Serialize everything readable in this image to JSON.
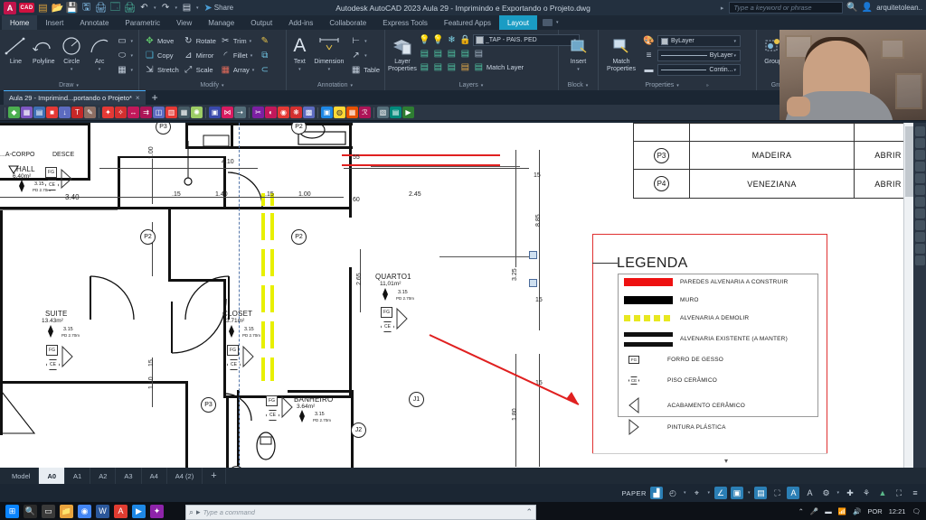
{
  "titlebar": {
    "app_title": "Autodesk AutoCAD 2023   Aula 29 - Imprimindo e Exportando o Projeto.dwg",
    "share_label": "Share",
    "search_placeholder": "Type a keyword or phrase",
    "user_name": "arquitetolean..",
    "quick_access": [
      "new-icon",
      "open-icon",
      "save-icon",
      "saveas-icon",
      "plot-icon",
      "print-icon",
      "undo-icon",
      "redo-icon"
    ]
  },
  "ribbon": {
    "tabs": [
      {
        "label": "Home",
        "state": "hover"
      },
      {
        "label": "Insert",
        "state": "normal"
      },
      {
        "label": "Annotate",
        "state": "normal"
      },
      {
        "label": "Parametric",
        "state": "normal"
      },
      {
        "label": "View",
        "state": "normal"
      },
      {
        "label": "Manage",
        "state": "normal"
      },
      {
        "label": "Output",
        "state": "normal"
      },
      {
        "label": "Add-ins",
        "state": "normal"
      },
      {
        "label": "Collaborate",
        "state": "normal"
      },
      {
        "label": "Express Tools",
        "state": "normal"
      },
      {
        "label": "Featured Apps",
        "state": "normal"
      },
      {
        "label": "Layout",
        "state": "active"
      }
    ],
    "panels": {
      "draw": {
        "title": "Draw",
        "tools": [
          "Line",
          "Polyline",
          "Circle",
          "Arc"
        ]
      },
      "modify": {
        "title": "Modify",
        "tools": [
          "Move",
          "Rotate",
          "Trim",
          "Copy",
          "Mirror",
          "Fillet",
          "Stretch",
          "Scale",
          "Array"
        ]
      },
      "annotation": {
        "title": "Annotation",
        "tools": [
          "Text",
          "Dimension",
          "Table"
        ]
      },
      "layers": {
        "title": "Layers",
        "layer_properties": "Layer\nProperties",
        "current_layer": "_TAP - PAIS. PED",
        "match_layer": "Match Layer"
      },
      "block": {
        "title": "Block",
        "insert": "Insert"
      },
      "properties": {
        "title": "Properties",
        "match_properties": "Match\nProperties",
        "color": "ByLayer",
        "linetype": "ByLayer",
        "lineweight": "Contin..."
      },
      "groups": {
        "title": "Groups",
        "group": "Group"
      }
    }
  },
  "document_tabs": {
    "active": "Aula 29 - Imprimind...portando o Projeto*",
    "close_label": "×",
    "new_label": "+"
  },
  "drawing": {
    "rooms": [
      {
        "name": "HALL",
        "area": "6.40m²"
      },
      {
        "name": "SUITE",
        "area": "13.43m²"
      },
      {
        "name": "CLOSET",
        "area": "3.71m²"
      },
      {
        "name": "QUARTO1",
        "area": "11,01m²"
      },
      {
        "name": "BANHEIRO",
        "area": "3.64m²"
      }
    ],
    "level_text": "3.15",
    "level_sub": "PD 2.70m",
    "annotations": [
      "...A-CORPO",
      "DESCE"
    ],
    "door_tags": [
      "P3",
      "P2",
      "P2",
      "P2",
      "P3",
      "P3"
    ],
    "window_tags": [
      "J1",
      "J2"
    ],
    "dimensions_h": [
      "4.10",
      "3.40",
      ".15",
      "1.40",
      ".15",
      "1.00",
      "2.45"
    ],
    "dimensions_v": [
      "55",
      "15",
      "60",
      "1.00",
      "2.65",
      "2.65",
      "8.85",
      "3.25",
      "15",
      "1.40",
      "1.80",
      "15",
      "15"
    ]
  },
  "schedule": {
    "rows": [
      {
        "tag": "P3",
        "material": "MADEIRA",
        "type": "ABRIR"
      },
      {
        "tag": "P4",
        "material": "VENEZIANA",
        "type": "ABRIR"
      }
    ]
  },
  "legend": {
    "title": "LEGENDA",
    "line_items": [
      {
        "label": "PAREDES ALVENARIA A CONSTRUIR",
        "color": "#ee1111",
        "style": "solid"
      },
      {
        "label": "MURO",
        "color": "#000000",
        "style": "solid"
      },
      {
        "label": "ALVENARIA A DEMOLIR",
        "color": "#e8e820",
        "style": "dashed"
      },
      {
        "label": "ALVENARIA EXISTENTE (A MANTER)",
        "color": "#111111",
        "style": "double"
      }
    ],
    "symbol_items": [
      {
        "symbol": "FG",
        "shape": "square",
        "label": "FORRO DE GESSO"
      },
      {
        "symbol": "CE",
        "shape": "hexagon",
        "label": "PISO CERÂMICO"
      },
      {
        "symbol": "",
        "shape": "triangle-left",
        "label": "ACABAMENTO CERÂMICO"
      },
      {
        "symbol": "",
        "shape": "triangle-right",
        "label": "PINTURA PLÁSTICA"
      }
    ],
    "border_color": "#e03030"
  },
  "command_line": {
    "placeholder": "Type a command"
  },
  "layout_tabs": {
    "items": [
      "Model",
      "A0",
      "A1",
      "A2",
      "A3",
      "A4",
      "A4 (2)"
    ],
    "active": "A0",
    "add_label": "+"
  },
  "statusbar": {
    "space_label": "PAPER",
    "toggles": [
      "viewport-icon",
      "osnap-icon",
      "polar-icon",
      "otrack-icon",
      "lineweight-icon",
      "transparency-icon",
      "annotation-scale-icon",
      "annotation-visibility-icon",
      "autoscale-icon",
      "workspace-icon",
      "customize-icon",
      "hardware-icon",
      "isolate-icon",
      "fullscreen-icon",
      "menu-icon"
    ]
  },
  "taskbar": {
    "language": "POR",
    "time": "12:21",
    "apps": [
      "start-icon",
      "search-icon",
      "taskview-icon",
      "explorer-icon",
      "chrome-icon",
      "word-icon",
      "autocad-icon",
      "media-icon",
      "photos-icon"
    ]
  }
}
